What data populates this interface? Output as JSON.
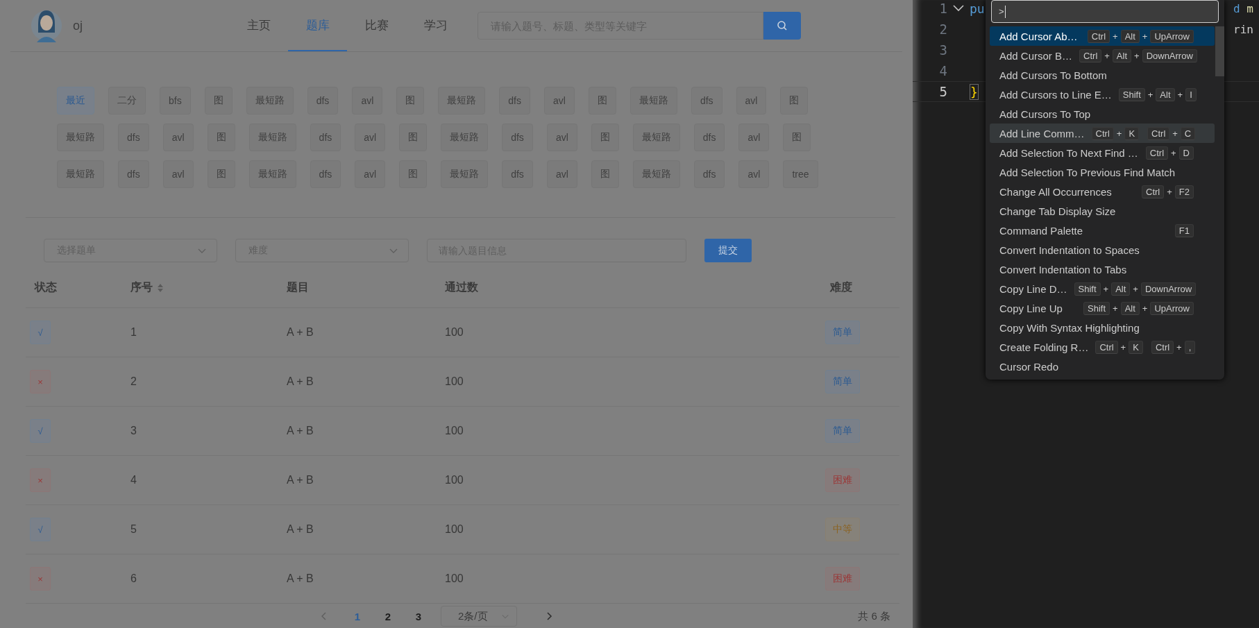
{
  "site": {
    "logo_text": "oj",
    "nav": [
      {
        "label": "主页",
        "selected": false
      },
      {
        "label": "题库",
        "selected": true
      },
      {
        "label": "比赛",
        "selected": false
      },
      {
        "label": "学习",
        "selected": false
      }
    ],
    "search": {
      "placeholder": "请输入题号、标题、类型等关键字"
    }
  },
  "tag_rows": [
    [
      {
        "label": "最近",
        "selected": true
      },
      {
        "label": "二分",
        "selected": false
      },
      {
        "label": "bfs",
        "selected": false
      },
      {
        "label": "图",
        "selected": false
      },
      {
        "label": "最短路",
        "selected": false
      },
      {
        "label": "dfs",
        "selected": false
      },
      {
        "label": "avl",
        "selected": false
      },
      {
        "label": "图",
        "selected": false
      },
      {
        "label": "最短路",
        "selected": false
      },
      {
        "label": "dfs",
        "selected": false
      },
      {
        "label": "avl",
        "selected": false
      },
      {
        "label": "图",
        "selected": false
      },
      {
        "label": "最短路",
        "selected": false
      },
      {
        "label": "dfs",
        "selected": false
      },
      {
        "label": "avl",
        "selected": false
      },
      {
        "label": "图",
        "selected": false
      }
    ],
    [
      {
        "label": "最短路",
        "selected": false
      },
      {
        "label": "dfs",
        "selected": false
      },
      {
        "label": "avl",
        "selected": false
      },
      {
        "label": "图",
        "selected": false
      },
      {
        "label": "最短路",
        "selected": false
      },
      {
        "label": "dfs",
        "selected": false
      },
      {
        "label": "avl",
        "selected": false
      },
      {
        "label": "图",
        "selected": false
      },
      {
        "label": "最短路",
        "selected": false
      },
      {
        "label": "dfs",
        "selected": false
      },
      {
        "label": "avl",
        "selected": false
      },
      {
        "label": "图",
        "selected": false
      },
      {
        "label": "最短路",
        "selected": false
      },
      {
        "label": "dfs",
        "selected": false
      },
      {
        "label": "avl",
        "selected": false
      },
      {
        "label": "图",
        "selected": false
      }
    ],
    [
      {
        "label": "最短路",
        "selected": false
      },
      {
        "label": "dfs",
        "selected": false
      },
      {
        "label": "avl",
        "selected": false
      },
      {
        "label": "图",
        "selected": false
      },
      {
        "label": "最短路",
        "selected": false
      },
      {
        "label": "dfs",
        "selected": false
      },
      {
        "label": "avl",
        "selected": false
      },
      {
        "label": "图",
        "selected": false
      },
      {
        "label": "最短路",
        "selected": false
      },
      {
        "label": "dfs",
        "selected": false
      },
      {
        "label": "avl",
        "selected": false
      },
      {
        "label": "图",
        "selected": false
      },
      {
        "label": "最短路",
        "selected": false
      },
      {
        "label": "dfs",
        "selected": false
      },
      {
        "label": "avl",
        "selected": false
      },
      {
        "label": "tree",
        "selected": false
      }
    ]
  ],
  "filters": {
    "problem_list": {
      "placeholder": "选择题单"
    },
    "difficulty": {
      "placeholder": "难度"
    },
    "keyword": {
      "placeholder": "请输入题目信息"
    },
    "submit": "提交"
  },
  "table": {
    "columns": [
      "状态",
      "序号",
      "题目",
      "通过数",
      "难度"
    ],
    "rows": [
      {
        "status": {
          "mark": "√",
          "passed": true
        },
        "number": "1",
        "title": "A + B",
        "accepted": "100",
        "difficulty": {
          "label": "简单",
          "kind": "easy"
        }
      },
      {
        "status": {
          "mark": "×",
          "passed": false
        },
        "number": "2",
        "title": "A + B",
        "accepted": "100",
        "difficulty": {
          "label": "简单",
          "kind": "easy"
        }
      },
      {
        "status": {
          "mark": "√",
          "passed": true
        },
        "number": "3",
        "title": "A + B",
        "accepted": "100",
        "difficulty": {
          "label": "简单",
          "kind": "easy"
        }
      },
      {
        "status": {
          "mark": "×",
          "passed": false
        },
        "number": "4",
        "title": "A + B",
        "accepted": "100",
        "difficulty": {
          "label": "困难",
          "kind": "hard"
        }
      },
      {
        "status": {
          "mark": "√",
          "passed": true
        },
        "number": "5",
        "title": "A + B",
        "accepted": "100",
        "difficulty": {
          "label": "中等",
          "kind": "medium"
        }
      },
      {
        "status": {
          "mark": "×",
          "passed": false
        },
        "number": "6",
        "title": "A + B",
        "accepted": "100",
        "difficulty": {
          "label": "困难",
          "kind": "hard"
        }
      }
    ]
  },
  "pagination": {
    "pages": [
      {
        "label": "1",
        "selected": true
      },
      {
        "label": "2",
        "selected": false
      },
      {
        "label": "3",
        "selected": false
      }
    ],
    "page_size": "2条/页",
    "total": "共 6 条"
  },
  "editor": {
    "lines": [
      {
        "number": "1",
        "current": false,
        "foldable": true,
        "left": [
          {
            "text": "pu",
            "kind": "keyword"
          }
        ],
        "right": [
          {
            "text": "d",
            "kind": "keyword"
          },
          {
            "text": " m",
            "kind": "function"
          }
        ]
      },
      {
        "number": "2",
        "current": false,
        "right": [
          {
            "text": "rin",
            "kind": "plain"
          }
        ]
      },
      {
        "number": "3",
        "current": false
      },
      {
        "number": "4",
        "current": false
      },
      {
        "number": "5",
        "current": true,
        "left": [
          {
            "text": "}",
            "kind": "bracket-match"
          }
        ]
      }
    ]
  },
  "command_palette": {
    "input_value": ">",
    "items": [
      {
        "label": "Add Cursor Ab…",
        "selected": true,
        "hovered": false,
        "keys": [
          [
            {
              "kind": "key",
              "text": "Ctrl"
            },
            {
              "kind": "sep",
              "text": "+"
            },
            {
              "kind": "key",
              "text": "Alt"
            },
            {
              "kind": "sep",
              "text": "+"
            },
            {
              "kind": "key",
              "text": "UpArrow"
            }
          ]
        ]
      },
      {
        "label": "Add Cursor B…",
        "selected": false,
        "hovered": false,
        "keys": [
          [
            {
              "kind": "key",
              "text": "Ctrl"
            },
            {
              "kind": "sep",
              "text": "+"
            },
            {
              "kind": "key",
              "text": "Alt"
            },
            {
              "kind": "sep",
              "text": "+"
            },
            {
              "kind": "key",
              "text": "DownArrow"
            }
          ]
        ]
      },
      {
        "label": "Add Cursors To Bottom",
        "selected": false,
        "hovered": false
      },
      {
        "label": "Add Cursors to Line E…",
        "selected": false,
        "hovered": false,
        "keys": [
          [
            {
              "kind": "key",
              "text": "Shift"
            },
            {
              "kind": "sep",
              "text": "+"
            },
            {
              "kind": "key",
              "text": "Alt"
            },
            {
              "kind": "sep",
              "text": "+"
            },
            {
              "kind": "key",
              "text": "I"
            }
          ]
        ]
      },
      {
        "label": "Add Cursors To Top",
        "selected": false,
        "hovered": false
      },
      {
        "label": "Add Line Comm…",
        "selected": false,
        "hovered": true,
        "keys": [
          [
            {
              "kind": "key",
              "text": "Ctrl"
            },
            {
              "kind": "sep",
              "text": "+"
            },
            {
              "kind": "key",
              "text": "K"
            }
          ],
          [
            {
              "kind": "key",
              "text": "Ctrl"
            },
            {
              "kind": "sep",
              "text": "+"
            },
            {
              "kind": "key",
              "text": "C"
            }
          ]
        ]
      },
      {
        "label": "Add Selection To Next Find …",
        "selected": false,
        "hovered": false,
        "keys": [
          [
            {
              "kind": "key",
              "text": "Ctrl"
            },
            {
              "kind": "sep",
              "text": "+"
            },
            {
              "kind": "key",
              "text": "D"
            }
          ]
        ]
      },
      {
        "label": "Add Selection To Previous Find Match",
        "selected": false,
        "hovered": false
      },
      {
        "label": "Change All Occurrences",
        "selected": false,
        "hovered": false,
        "keys": [
          [
            {
              "kind": "key",
              "text": "Ctrl"
            },
            {
              "kind": "sep",
              "text": "+"
            },
            {
              "kind": "key",
              "text": "F2"
            }
          ]
        ]
      },
      {
        "label": "Change Tab Display Size",
        "selected": false,
        "hovered": false
      },
      {
        "label": "Command Palette",
        "selected": false,
        "hovered": false,
        "keys": [
          [
            {
              "kind": "key",
              "text": "F1"
            }
          ]
        ]
      },
      {
        "label": "Convert Indentation to Spaces",
        "selected": false,
        "hovered": false
      },
      {
        "label": "Convert Indentation to Tabs",
        "selected": false,
        "hovered": false
      },
      {
        "label": "Copy Line D…",
        "selected": false,
        "hovered": false,
        "keys": [
          [
            {
              "kind": "key",
              "text": "Shift"
            },
            {
              "kind": "sep",
              "text": "+"
            },
            {
              "kind": "key",
              "text": "Alt"
            },
            {
              "kind": "sep",
              "text": "+"
            },
            {
              "kind": "key",
              "text": "DownArrow"
            }
          ]
        ]
      },
      {
        "label": "Copy Line Up",
        "selected": false,
        "hovered": false,
        "keys": [
          [
            {
              "kind": "key",
              "text": "Shift"
            },
            {
              "kind": "sep",
              "text": "+"
            },
            {
              "kind": "key",
              "text": "Alt"
            },
            {
              "kind": "sep",
              "text": "+"
            },
            {
              "kind": "key",
              "text": "UpArrow"
            }
          ]
        ]
      },
      {
        "label": "Copy With Syntax Highlighting",
        "selected": false,
        "hovered": false
      },
      {
        "label": "Create Folding R…",
        "selected": false,
        "hovered": false,
        "keys": [
          [
            {
              "kind": "key",
              "text": "Ctrl"
            },
            {
              "kind": "sep",
              "text": "+"
            },
            {
              "kind": "key",
              "text": "K"
            }
          ],
          [
            {
              "kind": "key",
              "text": "Ctrl"
            },
            {
              "kind": "sep",
              "text": "+"
            },
            {
              "kind": "key",
              "text": ","
            }
          ]
        ]
      },
      {
        "label": "Cursor Redo",
        "selected": false,
        "hovered": false
      }
    ]
  }
}
